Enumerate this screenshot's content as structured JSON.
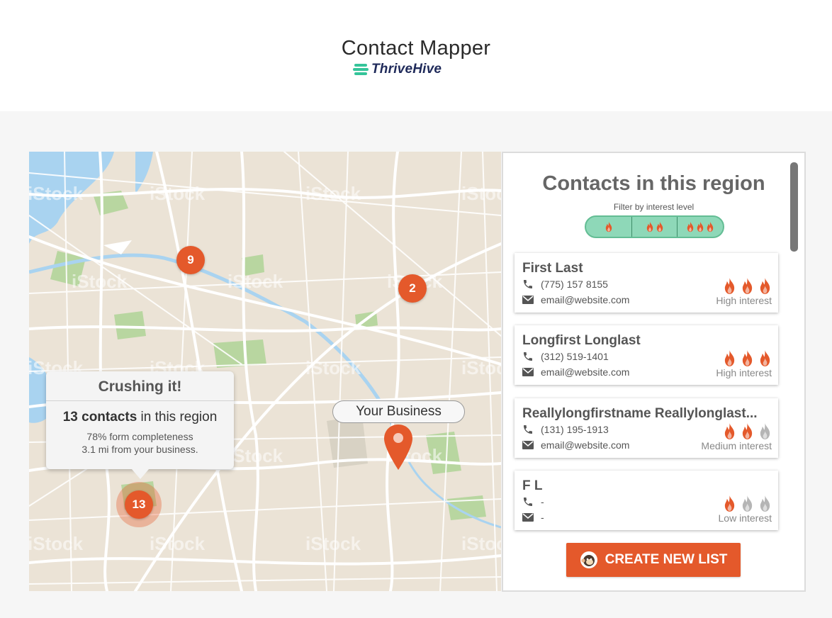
{
  "header": {
    "title": "Contact Mapper",
    "brand": "ThriveHive"
  },
  "map": {
    "watermark": "iStock",
    "clusters": [
      {
        "count": "9"
      },
      {
        "count": "2"
      },
      {
        "count": "13"
      }
    ],
    "callout": {
      "title": "Crushing it!",
      "count_bold": "13 contacts",
      "count_suffix": " in this region",
      "completeness": "78% form completeness",
      "distance": "3.1 mi from your business."
    },
    "business_label": "Your Business"
  },
  "panel": {
    "title": "Contacts in this region",
    "filter_label": "Filter by interest level",
    "filter_options": [
      1,
      2,
      3
    ],
    "contacts": [
      {
        "name": "First Last",
        "phone": "(775) 157 8155",
        "email": "email@website.com",
        "interest_label": "High interest",
        "interest_level": 3
      },
      {
        "name": "Longfirst Longlast",
        "phone": "(312) 519-1401",
        "email": "email@website.com",
        "interest_label": "High interest",
        "interest_level": 3
      },
      {
        "name": "Reallylongfirstname Reallylonglast...",
        "phone": "(131) 195-1913",
        "email": "email@website.com",
        "interest_label": "Medium interest",
        "interest_level": 2
      },
      {
        "name": "F L",
        "phone": "-",
        "email": "-",
        "interest_label": "Low interest",
        "interest_level": 1
      }
    ],
    "cta_label": "CREATE NEW LIST"
  },
  "colors": {
    "accent": "#e4592b",
    "filter_green": "#8ed8b8",
    "brand_navy": "#1f2a5a",
    "brand_green": "#35c49a",
    "flame_inactive": "#b5b5b5"
  },
  "icons": [
    "phone-icon",
    "mail-icon",
    "flame-icon",
    "map-pin-icon",
    "mailchimp-icon"
  ]
}
